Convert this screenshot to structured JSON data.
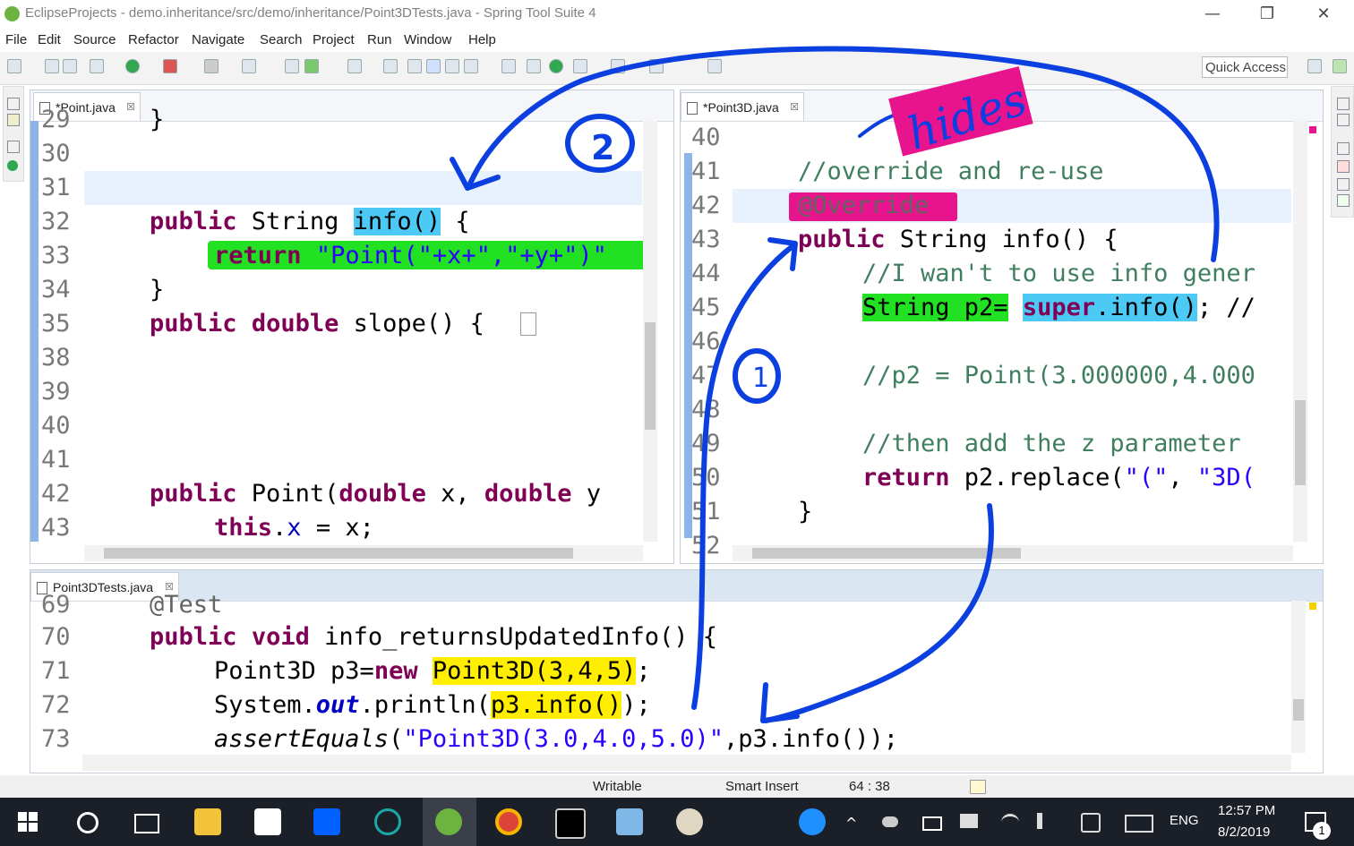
{
  "window": {
    "title": "EclipseProjects - demo.inheritance/src/demo/inheritance/Point3DTests.java - Spring Tool Suite 4",
    "min": "—",
    "max": "❐",
    "close": "✕"
  },
  "menu": [
    "File",
    "Edit",
    "Source",
    "Refactor",
    "Navigate",
    "Search",
    "Project",
    "Run",
    "Window",
    "Help"
  ],
  "toolbar": {
    "quick_access": "Quick Access"
  },
  "editor_left": {
    "tab": "*Point.java",
    "close": "☒",
    "line_numbers": [
      "29",
      "30",
      "31",
      "32",
      "33",
      "34",
      "35",
      "38",
      "39",
      "40",
      "41",
      "42",
      "43"
    ],
    "lines": {
      "l29": "}",
      "l32_kw": "public",
      "l32_a": " String ",
      "l32_hl": "info()",
      "l32_b": " {",
      "l33_kw": "return",
      "l33_st": "\"Point(\"+x+\",\"+y+\")\"",
      "l34": "}",
      "l35_kw1": "public",
      "l35_kw2": "double",
      "l35_a": " slope() {",
      "l42_kw": "public",
      "l42_a": " Point(",
      "l42_kw2": "double",
      "l42_b": " x, ",
      "l42_kw3": "double",
      "l42_c": " y",
      "l43_kw": "this",
      "l43_a": ".",
      "l43_f": "x",
      "l43_b": " = x;"
    }
  },
  "editor_right": {
    "tab": "*Point3D.java",
    "close": "☒",
    "line_numbers": [
      "40",
      "41",
      "42",
      "43",
      "44",
      "45",
      "46",
      "47",
      "48",
      "49",
      "50",
      "51",
      "52"
    ],
    "lines": {
      "l41": "//override and re-use",
      "l42": "@Override",
      "l43_kw": "public",
      "l43_a": " String info() {",
      "l44": "//I wan't to use info gener",
      "l45_hl": "String p2=",
      "l45_kw": "super",
      "l45_a": ".info()",
      "l45_b": "; //",
      "l47": "//p2 = Point(3.000000,4.000",
      "l49": "//then add the z parameter",
      "l50_kw": "return",
      "l50_a": " p2.replace(",
      "l50_s1": "\"(\"",
      "l50_b": ", ",
      "l50_s2": "\"3D(",
      "l51": "}"
    }
  },
  "editor_bottom": {
    "tab": "Point3DTests.java",
    "close": "☒",
    "line_numbers": [
      "69",
      "70",
      "71",
      "72",
      "73"
    ],
    "lines": {
      "l69": "@Test",
      "l70_kw1": "public",
      "l70_kw2": "void",
      "l70_a": " info_returnsUpdatedInfo() {",
      "l71_a": "Point3D p3=",
      "l71_kw": "new",
      "l71_hl": "Point3D(3,4,5)",
      "l71_b": ";",
      "l72_a": "System.",
      "l72_f": "out",
      "l72_b": ".println(",
      "l72_hl": "p3.info()",
      "l72_c": ");",
      "l73_m": "assertEquals",
      "l73_a": "(",
      "l73_s": "\"Point3D(3.0,4.0,5.0)\"",
      "l73_b": ",p3.info());"
    }
  },
  "annotations": {
    "hides": "hides",
    "circle_one": "1",
    "circle_two": "2"
  },
  "status": {
    "writable": "Writable",
    "insert_mode": "Smart Insert",
    "position": "64 : 38"
  },
  "taskbar": {
    "time": "12:57 PM",
    "date": "8/2/2019",
    "lang": "ENG",
    "notif_count": "1"
  },
  "colors": {
    "annotation_blue": "#0c3fe0",
    "highlight_green": "#22e022",
    "highlight_blue": "#4dc9f5",
    "highlight_yellow": "#ffee00",
    "highlight_pink": "#e8148e"
  }
}
